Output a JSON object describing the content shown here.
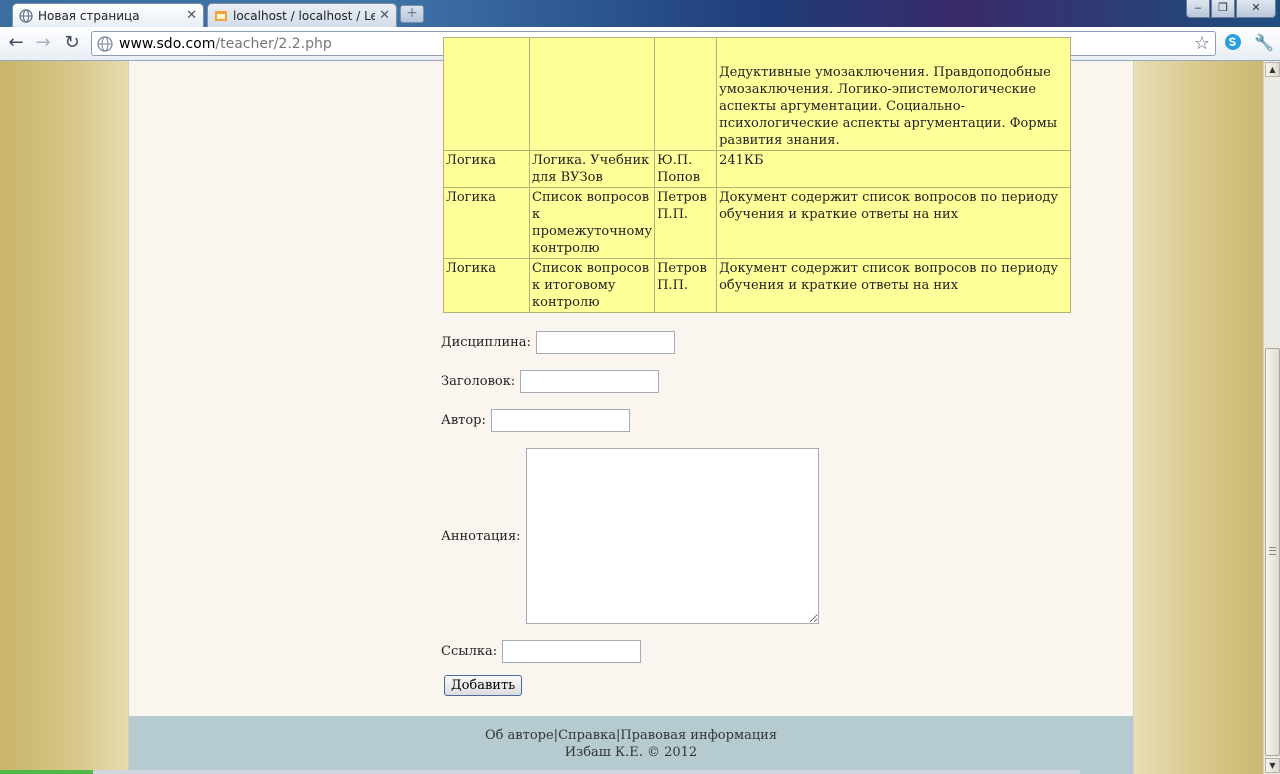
{
  "browser": {
    "tabs": [
      {
        "label": "Новая страница",
        "active": true
      },
      {
        "label": "localhost / localhost / LearnSys",
        "active": false
      }
    ],
    "new_tab": "+",
    "window_controls": {
      "minimize": "‒",
      "restore": "❐",
      "close": "✕"
    },
    "nav": {
      "back": "←",
      "forward": "→",
      "reload": "↻"
    },
    "url_host": "www.sdo.com",
    "url_path": "/teacher/2.2.php",
    "bookmark_star": "☆",
    "wrench": "🔧"
  },
  "table": {
    "rows": [
      {
        "discipline": "",
        "title": "",
        "author": "",
        "annotation": "Дедуктивные умозаключения. Правдоподобные умозаключения. Логико-эпистемологические аспекты аргументации. Социально-психологические аспекты аргументации. Формы развития знания."
      },
      {
        "discipline": "Логика",
        "title": "Логика. Учебник для ВУЗов",
        "author": "Ю.П. Попов",
        "annotation": "241КБ"
      },
      {
        "discipline": "Логика",
        "title": "Список вопросов к промежуточному контролю",
        "author": "Петров П.П.",
        "annotation": "Документ содержит список вопросов по периоду обучения и краткие ответы на них"
      },
      {
        "discipline": "Логика",
        "title": "Список вопросов к итоговому контролю",
        "author": "Петров П.П.",
        "annotation": "Документ содержит список вопросов по периоду обучения и краткие ответы на них"
      }
    ]
  },
  "form": {
    "discipline_label": "Дисциплина:",
    "discipline_value": "",
    "title_label": "Заголовок:",
    "title_value": "",
    "author_label": "Автор:",
    "author_value": "",
    "annotation_label": "Аннотация:",
    "annotation_value": "",
    "link_label": "Ссылка:",
    "link_value": "",
    "submit_label": "Добавить"
  },
  "footer": {
    "links": [
      "Об авторе",
      "Справка",
      "Правовая информация"
    ],
    "separator": "|",
    "copyright": "Избаш К.Е. © 2012"
  },
  "colors": {
    "table_bg": "#ffff99",
    "page_bg": "#faf6ef",
    "footer_bg": "#b6cbd0"
  }
}
